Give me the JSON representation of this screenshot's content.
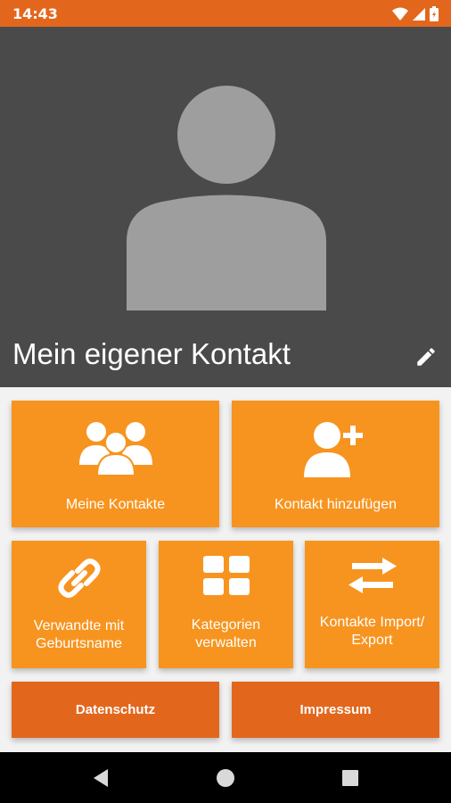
{
  "status_bar": {
    "time": "14:43",
    "icons": [
      "wifi-icon",
      "signal-icon",
      "battery-icon"
    ]
  },
  "header": {
    "title": "Mein eigener Kontakt",
    "edit_icon": "pencil-icon"
  },
  "tiles": {
    "my_contacts": {
      "label": "Meine Kontakte",
      "icon": "group-icon"
    },
    "add_contact": {
      "label": "Kontakt hinzufügen",
      "icon": "add-person-icon"
    },
    "relatives": {
      "label": "Verwandte mit Geburtsname",
      "icon": "link-icon"
    },
    "categories": {
      "label": "Kategorien verwalten",
      "icon": "grid-icon"
    },
    "import_export": {
      "label": "Kontakte Import/ Export",
      "icon": "swap-arrows-icon"
    },
    "privacy": {
      "label": "Datenschutz"
    },
    "imprint": {
      "label": "Impressum"
    }
  },
  "colors": {
    "accent": "#f7941f",
    "accent_dark": "#e2671d",
    "hero_bg": "#4a4a4a"
  },
  "nav": [
    "back-icon",
    "home-icon",
    "recents-icon"
  ]
}
